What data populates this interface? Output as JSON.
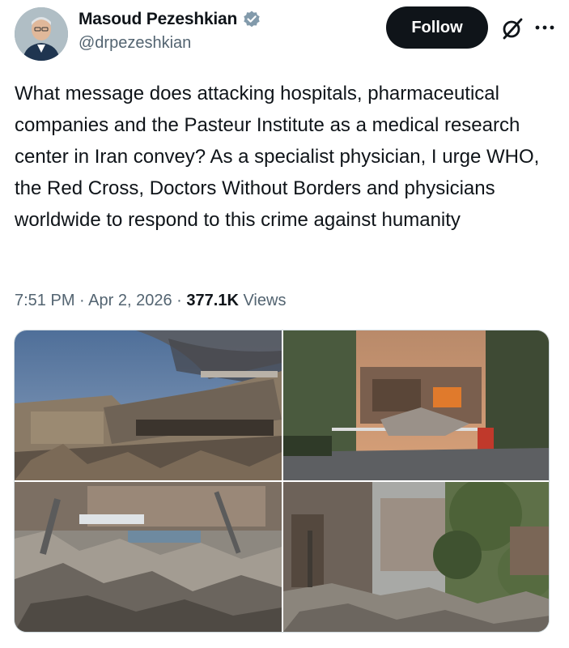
{
  "author": {
    "display_name": "Masoud Pezeshkian",
    "handle": "@drpezeshkian",
    "verified_icon": "verified-badge-icon"
  },
  "actions": {
    "follow_label": "Follow",
    "grok_icon": "grok-icon",
    "more_icon": "more-options-icon"
  },
  "tweet": {
    "text": "What message does attacking hospitals, pharmaceutical companies and the Pasteur Institute as a medical research center in Iran convey? As a specialist physician, I urge WHO, the Red Cross, Doctors Without Borders and physicians worldwide to respond to this crime against humanity",
    "time": "7:51 PM",
    "date": "Apr 2, 2026",
    "views_count": "377.1K",
    "views_label": "Views",
    "separator": "·"
  },
  "colors": {
    "text_primary": "#0f1419",
    "text_secondary": "#536471",
    "verified_badge": "#829aab",
    "follow_bg": "#0f1419"
  }
}
